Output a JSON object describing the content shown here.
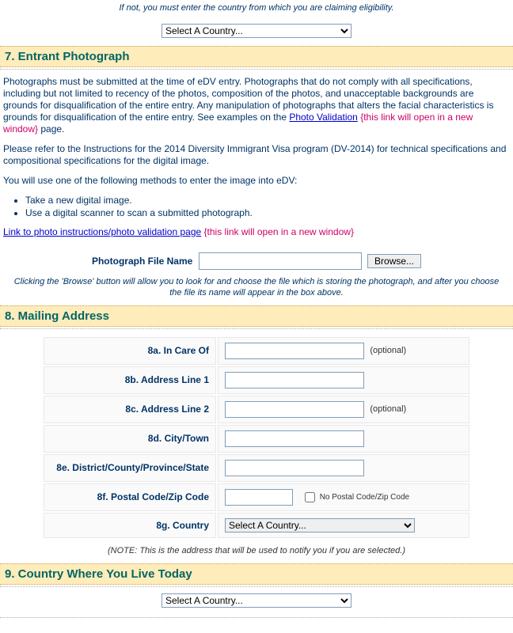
{
  "top_note": "If not, you must enter the country from which you are claiming eligibility.",
  "select_country_placeholder": "Select A Country...",
  "section7": {
    "title": "7. Entrant Photograph",
    "para1_pre": "Photographs must be submitted at the time of eDV entry. Photographs that do not comply with all specifications, including but not limited to recency of the photos, composition of the photos, and unacceptable backgrounds are grounds for disqualification of the entire entry. Any manipulation of photographs that alters the facial characteristics is grounds for disqualification of the entire entry. See examples on the ",
    "photo_validation_link": "Photo Validation",
    "new_window_hint": "{this link will open in a new window}",
    "para1_post": " page.",
    "para2": "Please refer to the Instructions for the 2014 Diversity Immigrant Visa program (DV-2014) for technical specifications and compositional specifications for the digital image.",
    "para3": "You will use one of the following methods to enter the image into eDV:",
    "method1": "Take a new digital image.",
    "method2": "Use a digital scanner to scan a submitted photograph.",
    "link_to_photo_instructions": "Link to photo instructions/photo validation page",
    "photo_label": "Photograph File Name",
    "browse_btn": "Browse...",
    "browse_hint": "Clicking the 'Browse' button will allow you to look for and choose the file which is storing the photograph, and after you choose the file its name will appear in the box above."
  },
  "section8": {
    "title": "8. Mailing Address",
    "fields": {
      "a": "8a. In Care Of",
      "b": "8b. Address Line 1",
      "c": "8c. Address Line 2",
      "d": "8d. City/Town",
      "e": "8e. District/County/Province/State",
      "f": "8f. Postal Code/Zip Code",
      "g": "8g. Country"
    },
    "optional_hint": "(optional)",
    "no_postal_label": "No Postal Code/Zip Code",
    "note": "(NOTE: This is the address that will be used to notify you if you are selected.)"
  },
  "section9": {
    "title": "9. Country Where You Live Today"
  }
}
